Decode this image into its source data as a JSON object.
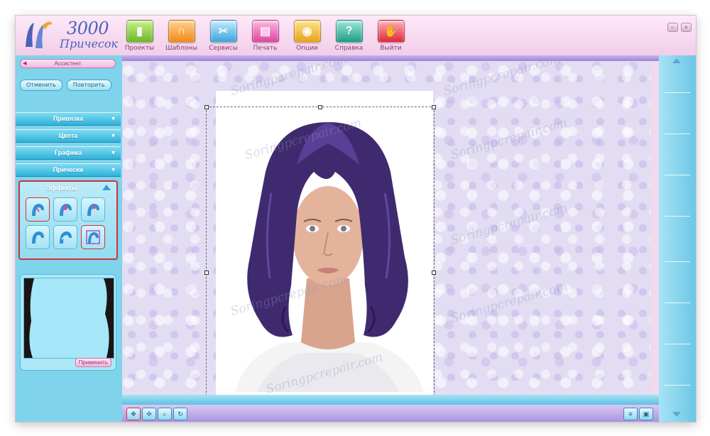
{
  "app": {
    "logo_title": "3000",
    "logo_subtitle": "Причесок"
  },
  "toolbar": [
    {
      "label": "Проекты",
      "icon": "projects-icon",
      "color": "#8dcf3f"
    },
    {
      "label": "Шаблоны",
      "icon": "templates-icon",
      "color": "#f5a12a"
    },
    {
      "label": "Сервисы",
      "icon": "services-icon",
      "color": "#56b6e6"
    },
    {
      "label": "Печать",
      "icon": "print-icon",
      "color": "#e85fb1"
    },
    {
      "label": "Опции",
      "icon": "options-icon",
      "color": "#f2b731"
    },
    {
      "label": "Справка",
      "icon": "help-icon",
      "color": "#2fb59d"
    },
    {
      "label": "Выйти",
      "icon": "exit-icon",
      "color": "#e8404f"
    }
  ],
  "sidebar": {
    "assistant": "Ассистент",
    "undo": "Отменить",
    "redo": "Повторить",
    "sections": [
      "Привязка",
      "Цвета",
      "Графика",
      "Прически"
    ],
    "effects_title": "Эффекты",
    "apply": "Применить"
  },
  "watermark_text": "Soringpcrepair.com",
  "colors": {
    "hair": "#3f2a6f",
    "accent_cyan": "#2fb2da",
    "selection_red": "#d1303a"
  }
}
